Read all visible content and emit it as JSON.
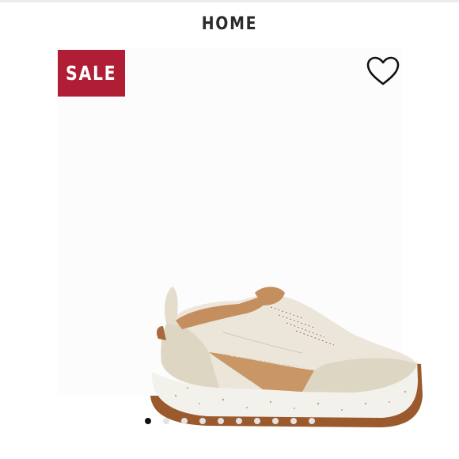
{
  "header": {
    "title": "HOME"
  },
  "badge": {
    "label": "SALE",
    "color": "#b01e35"
  },
  "wishlist": {
    "icon": "heart-outline-icon"
  },
  "product_image": {
    "subject": "shoe-illustration"
  },
  "carousel": {
    "total": 10,
    "active_index": 0
  }
}
